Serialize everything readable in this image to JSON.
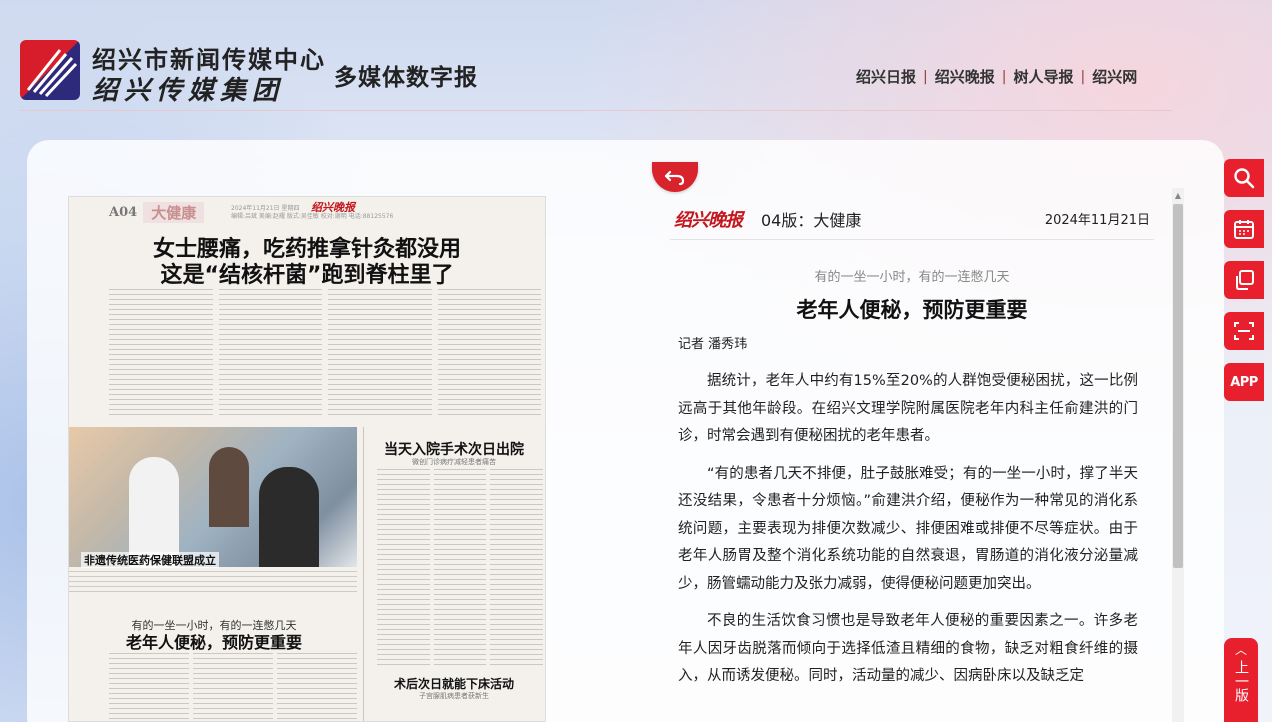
{
  "header": {
    "org_name": "绍兴市新闻传媒中心",
    "group_name": "绍兴传媒集团",
    "site_title": "多媒体数字报",
    "nav": [
      "绍兴日报",
      "绍兴晚报",
      "树人导报",
      "绍兴网"
    ],
    "nav_sep": "|"
  },
  "paper_page": {
    "page_no": "A04",
    "section": "大健康",
    "masthead": "绍兴晚报",
    "meta_line1": "2024年11月21日 星期四",
    "meta_line2": "编辑:吕斌 美编:赵耀 版式:吴佳敏 校对:谢明 电话:88125576",
    "headline_line1": "女士腰痛，吃药推拿针灸都没用",
    "headline_line2": "这是“结核杆菌”跑到脊柱里了",
    "photo_caption": "非遗传统医药保健联盟成立",
    "side_title": "当天入院手术次日出院",
    "side_subtitle": "微创门诊病疗减轻患者痛苦",
    "article_kicker": "有的一坐一小时，有的一连憋几天",
    "article_title": "老年人便秘，预防更重要",
    "bottom_title": "术后次日就能下床活动",
    "bottom_subtitle": "子宫腺肌病患者获新生"
  },
  "article": {
    "masthead": "绍兴晚报",
    "edition": "04版：大健康",
    "date": "2024年11月21日",
    "kicker": "有的一坐一小时，有的一连憋几天",
    "title": "老年人便秘，预防更重要",
    "byline": "记者 潘秀玮",
    "paragraphs": [
      "据统计，老年人中约有15%至20%的人群饱受便秘困扰，这一比例远高于其他年龄段。在绍兴文理学院附属医院老年内科主任俞建洪的门诊，时常会遇到有便秘困扰的老年患者。",
      "“有的患者几天不排便，肚子鼓胀难受；有的一坐一小时，撑了半天还没结果，令患者十分烦恼。”俞建洪介绍，便秘作为一种常见的消化系统问题，主要表现为排便次数减少、排便困难或排便不尽等症状。由于老年人肠胃及整个消化系统功能的自然衰退，胃肠道的消化液分泌量减少，肠管蠕动能力及张力减弱，使得便秘问题更加突出。",
      "不良的生活饮食习惯也是导致老年人便秘的重要因素之一。许多老年人因牙齿脱落而倾向于选择低渣且精细的食物，缺乏对粗食纤维的摄入，从而诱发便秘。同时，活动量的减少、因病卧床以及缺乏定"
    ]
  },
  "toolbar": {
    "items": [
      "search-icon",
      "calendar-icon",
      "copy-icon",
      "scan-icon"
    ],
    "app_label": "APP",
    "top_label": "上一版"
  },
  "colors": {
    "brand_red": "#e8202e",
    "masthead_red": "#c4161c"
  }
}
